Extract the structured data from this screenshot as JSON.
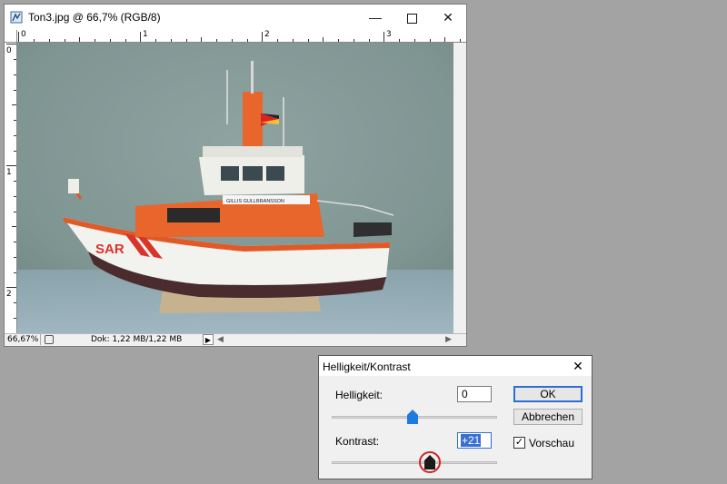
{
  "document_window": {
    "title": "Ton3.jpg @ 66,7% (RGB/8)",
    "minimize_glyph": "—",
    "close_glyph": "✕",
    "ruler_h_ticks": [
      "0",
      "1",
      "2",
      "3"
    ],
    "ruler_v_ticks": [
      "0",
      "1",
      "2"
    ],
    "status": {
      "zoom": "66,67%",
      "doc_info": "Dok: 1,22 MB/1,22 MB",
      "arrow_glyph": "▶"
    },
    "hscroll": {
      "left_arrow": "◀",
      "right_arrow": "▶"
    },
    "image": {
      "subject": "SAR rescue boat model",
      "hull_text": "SAR",
      "nameplate_text": "GILLIS GULLBRANSSON"
    }
  },
  "dialog": {
    "title": "Helligkeit/Kontrast",
    "close_glyph": "✕",
    "brightness": {
      "label": "Helligkeit:",
      "value": "0"
    },
    "contrast": {
      "label": "Kontrast:",
      "value": "+21"
    },
    "ok_label": "OK",
    "cancel_label": "Abbrechen",
    "preview": {
      "label": "Vorschau",
      "checked": true,
      "check_glyph": "✓"
    }
  },
  "colors": {
    "accent": "#2d6ed3",
    "highlight_ring": "#d42020",
    "thumb_blue": "#1f7ae0"
  }
}
